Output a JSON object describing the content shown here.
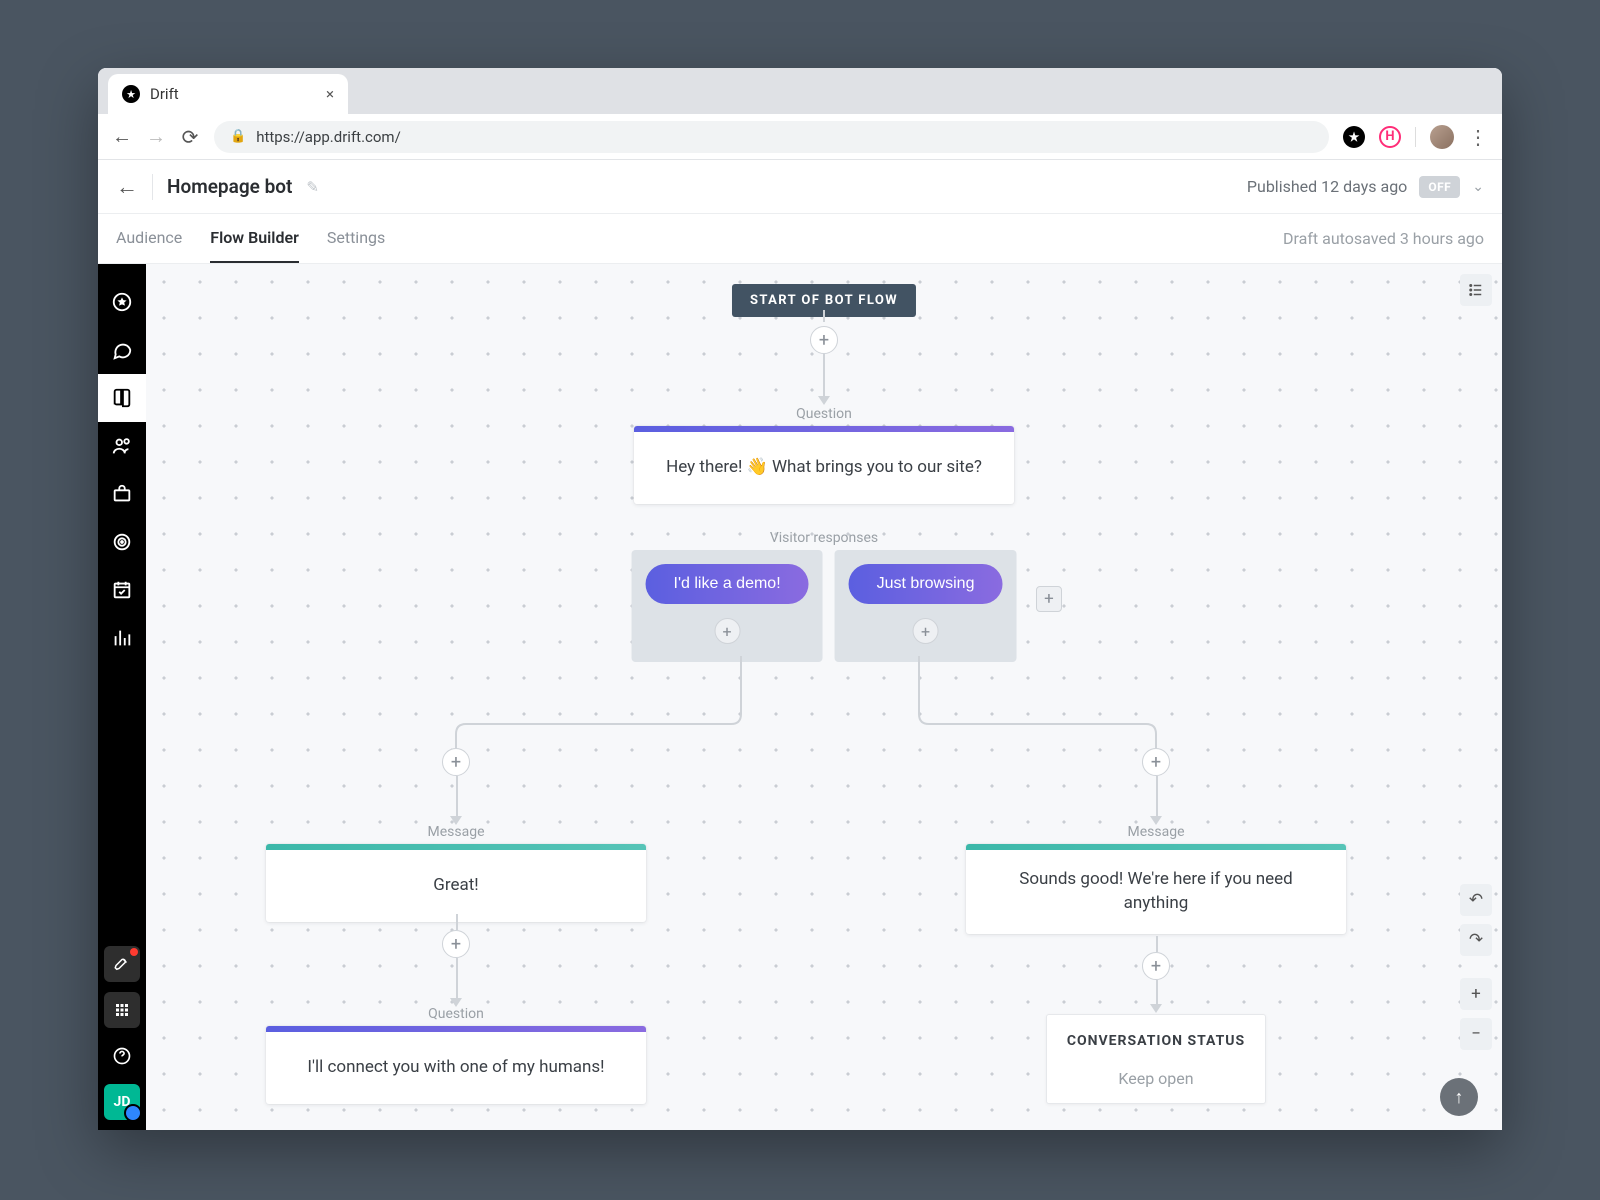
{
  "browser": {
    "tab_title": "Drift",
    "url": "https://app.drift.com/",
    "ext2_letter": "H"
  },
  "header": {
    "title": "Homepage bot",
    "published_text": "Published 12 days ago",
    "toggle_label": "OFF"
  },
  "tabs": {
    "audience": "Audience",
    "flow_builder": "Flow Builder",
    "settings": "Settings",
    "autosave": "Draft autosaved 3 hours ago",
    "active": "flow_builder"
  },
  "flow": {
    "start_chip": "START OF BOT FLOW",
    "q1_label": "Question",
    "q1_text": "Hey there! 👋 What brings you to our site?",
    "responses_label": "Visitor responses",
    "resp1": "I'd like a demo!",
    "resp2": "Just browsing",
    "left": {
      "msg_label": "Message",
      "msg_text": "Great!",
      "q2_label": "Question",
      "q2_text": "I'll connect you with one of my humans!"
    },
    "right": {
      "msg_label": "Message",
      "msg_text": "Sounds good! We're here if you need anything",
      "status_header": "CONVERSATION STATUS",
      "status_value": "Keep open"
    }
  }
}
